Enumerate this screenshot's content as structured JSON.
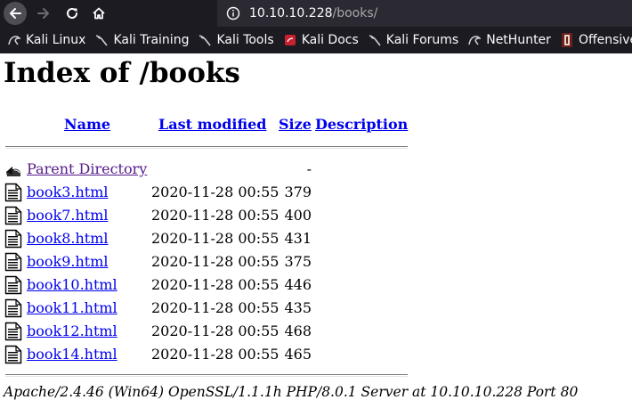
{
  "browser": {
    "url_host": "10.10.10.228",
    "url_path": "/books/",
    "bookmarks": [
      {
        "label": "Kali Linux",
        "icon": "kali-dragon-icon"
      },
      {
        "label": "Kali Training",
        "icon": "kali-dragon-icon"
      },
      {
        "label": "Kali Tools",
        "icon": "kali-dragon-icon"
      },
      {
        "label": "Kali Docs",
        "icon": "kali-docs-icon"
      },
      {
        "label": "Kali Forums",
        "icon": "kali-dragon-icon"
      },
      {
        "label": "NetHunter",
        "icon": "kali-dragon-icon"
      },
      {
        "label": "Offensive S",
        "icon": "offsec-icon"
      }
    ]
  },
  "page": {
    "title": "Index of /books",
    "columns": {
      "name": "Name",
      "last_modified": "Last modified",
      "size": "Size",
      "description": "Description"
    },
    "parent": {
      "label": "Parent Directory",
      "size": "-"
    },
    "files": [
      {
        "name": "book3.html",
        "modified": "2020-11-28 00:55",
        "size": "379"
      },
      {
        "name": "book7.html",
        "modified": "2020-11-28 00:55",
        "size": "400"
      },
      {
        "name": "book8.html",
        "modified": "2020-11-28 00:55",
        "size": "431"
      },
      {
        "name": "book9.html",
        "modified": "2020-11-28 00:55",
        "size": "375"
      },
      {
        "name": "book10.html",
        "modified": "2020-11-28 00:55",
        "size": "446"
      },
      {
        "name": "book11.html",
        "modified": "2020-11-28 00:55",
        "size": "435"
      },
      {
        "name": "book12.html",
        "modified": "2020-11-28 00:55",
        "size": "468"
      },
      {
        "name": "book14.html",
        "modified": "2020-11-28 00:55",
        "size": "465"
      }
    ],
    "footer": "Apache/2.4.46 (Win64) OpenSSL/1.1.1h PHP/8.0.1 Server at 10.10.10.228 Port 80"
  },
  "colors": {
    "link": "#0000ee",
    "visited_link": "#551a8b",
    "chrome_bg": "#1c1b22",
    "urlbar_bg": "#2b2a33"
  }
}
